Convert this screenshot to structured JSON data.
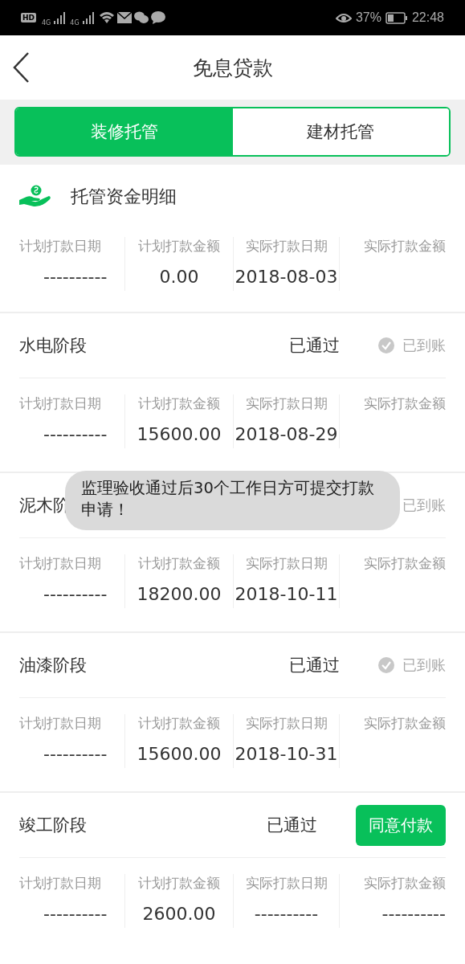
{
  "status_bar": {
    "hd": "HD",
    "networks": [
      "4G",
      "4G"
    ],
    "battery": "37%",
    "time": "22:48"
  },
  "header": {
    "title": "免息贷款"
  },
  "tabs": [
    {
      "label": "装修托管",
      "selected": true
    },
    {
      "label": "建材托管",
      "selected": false
    }
  ],
  "section": {
    "title": "托管资金明细"
  },
  "summary": {
    "columns": [
      "计划打款日期",
      "计划打款金额",
      "实际打款日期",
      "实际打款金额"
    ],
    "cells": [
      "----------",
      "0.00",
      "2018-08-03",
      ""
    ]
  },
  "stages": [
    {
      "name": "水电阶段",
      "status": "已通过",
      "action": {
        "kind": "received",
        "check": true,
        "label": "已到账"
      },
      "columns": [
        "计划打款日期",
        "计划打款金额",
        "实际打款日期",
        "实际打款金额"
      ],
      "cells": [
        "----------",
        "15600.00",
        "2018-08-29",
        ""
      ]
    },
    {
      "name": "泥木阶",
      "action": {
        "kind": "received",
        "check": false,
        "label": "已到账"
      },
      "columns": [
        "计划打款日期",
        "计划打款金额",
        "实际打款日期",
        "实际打款金额"
      ],
      "cells": [
        "----------",
        "18200.00",
        "2018-10-11",
        ""
      ]
    },
    {
      "name": "油漆阶段",
      "status": "已通过",
      "action": {
        "kind": "received",
        "check": true,
        "label": "已到账"
      },
      "columns": [
        "计划打款日期",
        "计划打款金额",
        "实际打款日期",
        "实际打款金额"
      ],
      "cells": [
        "----------",
        "15600.00",
        "2018-10-31",
        ""
      ]
    },
    {
      "name": "竣工阶段",
      "status": "已通过",
      "action": {
        "kind": "button",
        "label": "同意付款"
      },
      "columns": [
        "计划打款日期",
        "计划打款金额",
        "实际打款日期",
        "实际打款金额"
      ],
      "cells": [
        "----------",
        "2600.00",
        "----------",
        "----------"
      ]
    }
  ],
  "toast": {
    "text": "监理验收通过后30个工作日方可提交打款申请！"
  }
}
